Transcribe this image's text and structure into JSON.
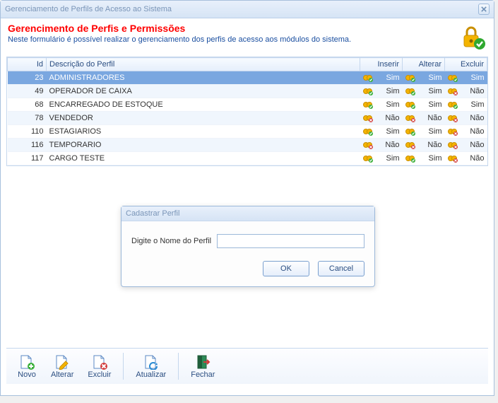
{
  "window": {
    "title": "Gerenciamento de Perfils de Acesso ao Sistema"
  },
  "header": {
    "title": "Gerencimento de Perfis e Permissões",
    "subtitle": "Neste formulário é possível realizar o gerenciamento dos perfis de acesso aos módulos do sistema."
  },
  "columns": {
    "id": "Id",
    "desc": "Descrição do Perfil",
    "insert": "Inserir",
    "update": "Alterar",
    "delete": "Excluir"
  },
  "perm_labels": {
    "yes": "Sim",
    "no": "Não"
  },
  "rows": [
    {
      "id": 23,
      "desc": "ADMINISTRADORES",
      "insert": "Sim",
      "update": "Sim",
      "delete": "Sim",
      "selected": true
    },
    {
      "id": 49,
      "desc": "OPERADOR DE CAIXA",
      "insert": "Sim",
      "update": "Sim",
      "delete": "Não"
    },
    {
      "id": 68,
      "desc": "ENCARREGADO DE ESTOQUE",
      "insert": "Sim",
      "update": "Sim",
      "delete": "Sim"
    },
    {
      "id": 78,
      "desc": "VENDEDOR",
      "insert": "Não",
      "update": "Não",
      "delete": "Não"
    },
    {
      "id": 110,
      "desc": "ESTAGIARIOS",
      "insert": "Sim",
      "update": "Sim",
      "delete": "Não"
    },
    {
      "id": 116,
      "desc": "TEMPORARIO",
      "insert": "Não",
      "update": "Não",
      "delete": "Não"
    },
    {
      "id": 117,
      "desc": "CARGO TESTE",
      "insert": "Sim",
      "update": "Sim",
      "delete": "Não"
    }
  ],
  "toolbar": {
    "novo": "Novo",
    "alterar": "Alterar",
    "excluir": "Excluir",
    "atualizar": "Atualizar",
    "fechar": "Fechar"
  },
  "modal": {
    "title": "Cadastrar Perfil",
    "label": "Digite o Nome do Perfil",
    "value": "",
    "ok": "OK",
    "cancel": "Cancel"
  }
}
